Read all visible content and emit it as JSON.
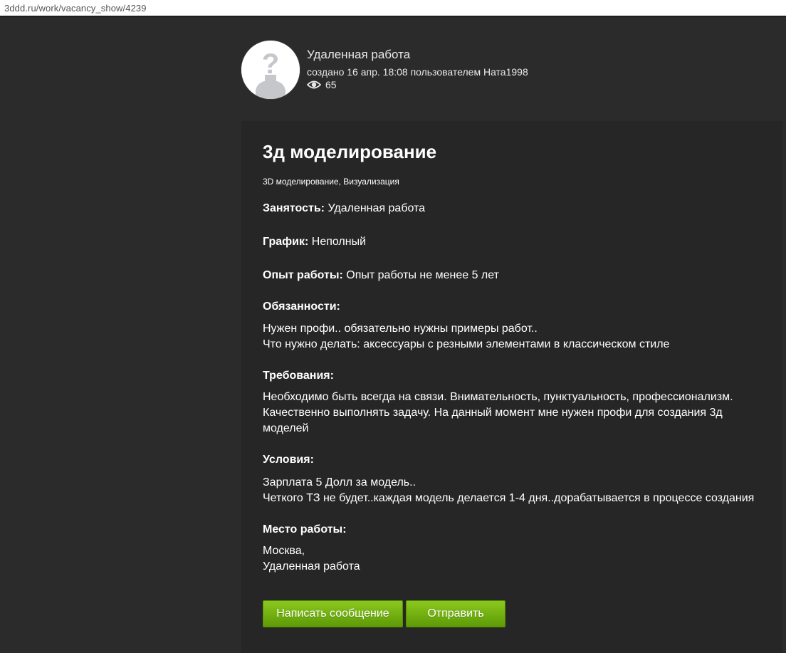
{
  "browser": {
    "url": "3ddd.ru/work/vacancy_show/4239"
  },
  "header": {
    "title": "Удаленная работа",
    "meta": "создано 16 апр. 18:08 пользователем Ната1998",
    "views": "65"
  },
  "vacancy": {
    "title": "3д моделирование",
    "tags": "3D моделирование, Визуализация",
    "employment_label": "Занятость:",
    "employment_value": " Удаленная работа",
    "schedule_label": "График:",
    "schedule_value": " Неполный",
    "experience_label": "Опыт работы:",
    "experience_value": " Опыт работы не менее 5 лет",
    "duties_label": "Обязанности:",
    "duties_text": "Нужен профи.. обязательно нужны примеры работ..\nЧто нужно делать: аксессуары с резными элементами в классическом стиле",
    "requirements_label": "Требования:",
    "requirements_text": "Необходимо быть всегда на связи. Внимательность, пунктуальность, профессионализм. Качественно выполнять задачу. На данный момент мне нужен профи для создания 3д моделей",
    "conditions_label": "Условия:",
    "conditions_text": "Зарплата 5 Долл за модель..\nЧеткого ТЗ не будет..каждая модель делается 1-4 дня..дорабатывается в процессе создания",
    "location_label": "Место работы:",
    "location_text": "Москва,\nУдаленная работа"
  },
  "actions": {
    "message_label": "Написать сообщение",
    "send_label": "Отправить"
  },
  "colors": {
    "background": "#2b2b2b",
    "card": "#262626",
    "button_green": "#74b213"
  },
  "icons": {
    "avatar": "placeholder-user-question-icon",
    "views": "eye-icon"
  }
}
